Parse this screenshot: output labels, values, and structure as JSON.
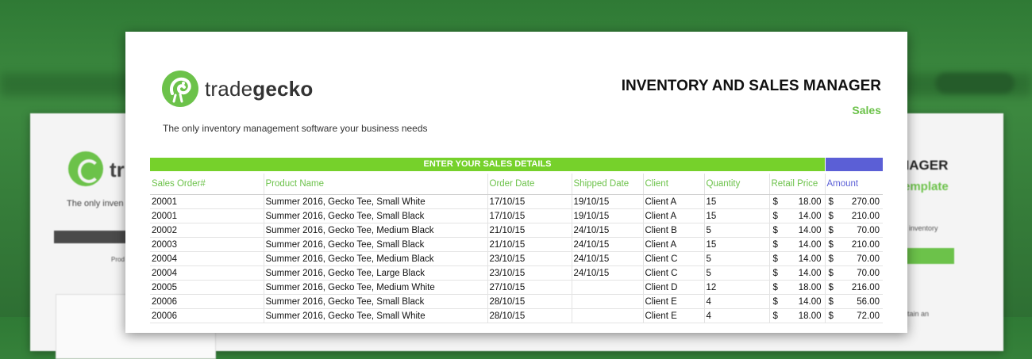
{
  "back_sheet": {
    "brand": "tr",
    "tagline": "The only inven",
    "small_left": "Prod",
    "title": "NAGER",
    "subtitle": "emplate",
    "small_right": "c inventory",
    "small_right2": "ntain an"
  },
  "header": {
    "brand_part1": "trade",
    "brand_part2": "gecko",
    "tagline": "The only inventory management software your business needs",
    "title": "INVENTORY AND SALES MANAGER",
    "subtitle": "Sales"
  },
  "section": {
    "label": "ENTER YOUR SALES DETAILS"
  },
  "table": {
    "columns": [
      "Sales Order#",
      "Product Name",
      "Order Date",
      "Shipped Date",
      "Client",
      "Quantity",
      "Retail Price",
      "Amount"
    ],
    "currency": "$",
    "rows": [
      {
        "order": "20001",
        "product": "Summer 2016, Gecko Tee, Small White",
        "order_date": "17/10/15",
        "shipped": "19/10/15",
        "client": "Client A",
        "qty": "15",
        "price": "18.00",
        "amount": "270.00"
      },
      {
        "order": "20001",
        "product": "Summer 2016, Gecko Tee, Small Black",
        "order_date": "17/10/15",
        "shipped": "19/10/15",
        "client": "Client A",
        "qty": "15",
        "price": "14.00",
        "amount": "210.00"
      },
      {
        "order": "20002",
        "product": "Summer 2016, Gecko Tee, Medium Black",
        "order_date": "21/10/15",
        "shipped": "24/10/15",
        "client": "Client B",
        "qty": "5",
        "price": "14.00",
        "amount": "70.00"
      },
      {
        "order": "20003",
        "product": "Summer 2016, Gecko Tee, Small Black",
        "order_date": "21/10/15",
        "shipped": "24/10/15",
        "client": "Client A",
        "qty": "15",
        "price": "14.00",
        "amount": "210.00"
      },
      {
        "order": "20004",
        "product": "Summer 2016, Gecko Tee, Medium Black",
        "order_date": "23/10/15",
        "shipped": "24/10/15",
        "client": "Client C",
        "qty": "5",
        "price": "14.00",
        "amount": "70.00"
      },
      {
        "order": "20004",
        "product": "Summer 2016, Gecko Tee, Large Black",
        "order_date": "23/10/15",
        "shipped": "24/10/15",
        "client": "Client C",
        "qty": "5",
        "price": "14.00",
        "amount": "70.00"
      },
      {
        "order": "20005",
        "product": "Summer 2016, Gecko Tee, Medium White",
        "order_date": "27/10/15",
        "shipped": "",
        "client": "Client D",
        "qty": "12",
        "price": "18.00",
        "amount": "216.00"
      },
      {
        "order": "20006",
        "product": "Summer 2016, Gecko Tee, Small Black",
        "order_date": "28/10/15",
        "shipped": "",
        "client": "Client E",
        "qty": "4",
        "price": "14.00",
        "amount": "56.00"
      },
      {
        "order": "20006",
        "product": "Summer 2016, Gecko Tee, Small White",
        "order_date": "28/10/15",
        "shipped": "",
        "client": "Client E",
        "qty": "4",
        "price": "18.00",
        "amount": "72.00"
      }
    ]
  },
  "colors": {
    "brand_green": "#6cc24a",
    "bar_green": "#76d12b",
    "accent_blue": "#5b5fd6",
    "background_green": "#2f7a35"
  },
  "icons": {
    "logo": "gecko-logo-icon"
  }
}
